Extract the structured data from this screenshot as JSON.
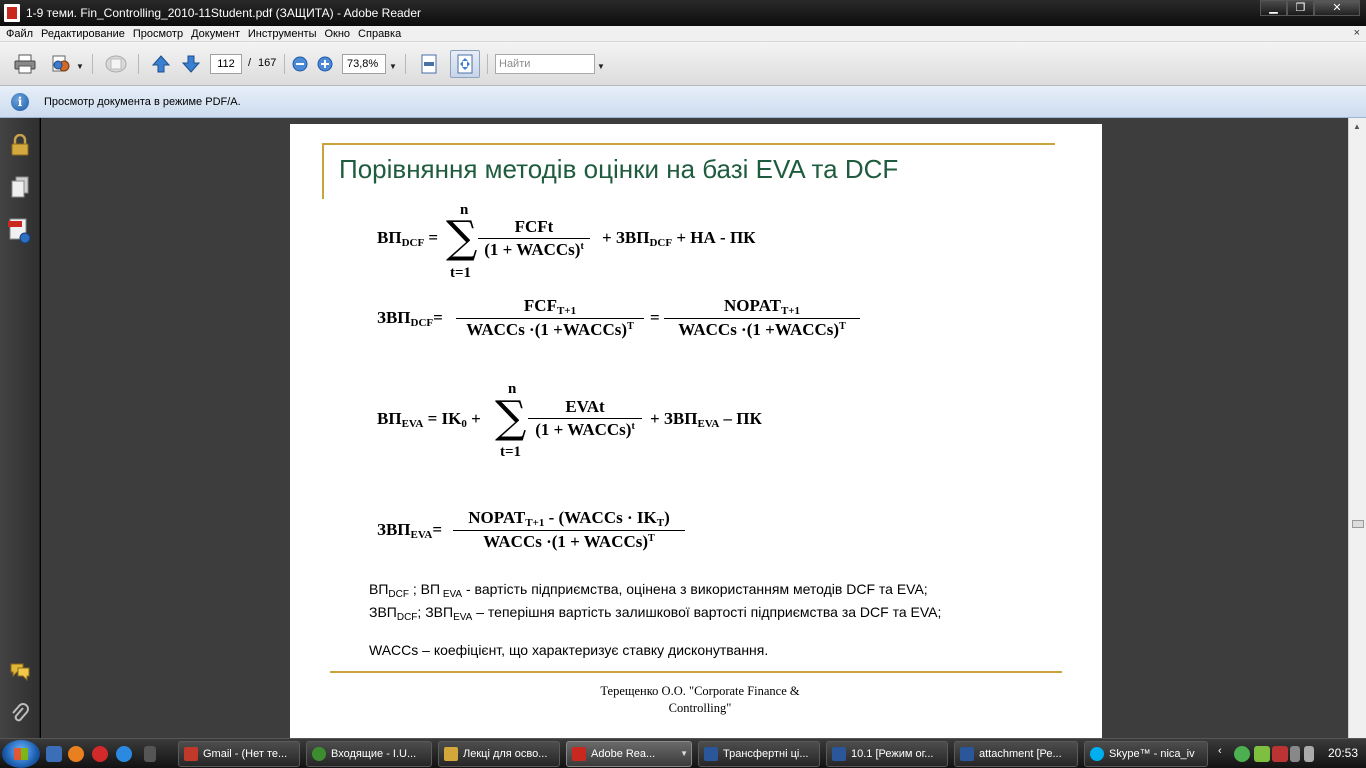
{
  "window": {
    "title": "1-9 теми. Fin_Controlling_2010-11Student.pdf (ЗАЩИТА) - Adobe Reader",
    "min": "▁",
    "max": "❐",
    "close": "✕"
  },
  "menu": {
    "items": [
      "Файл",
      "Редактирование",
      "Просмотр",
      "Документ",
      "Инструменты",
      "Окно",
      "Справка"
    ],
    "close": "×"
  },
  "toolbar": {
    "page_current": "112",
    "page_sep": "/",
    "page_total": "167",
    "zoom": "73,8%",
    "search_placeholder": "Найти"
  },
  "infobar": {
    "icon": "i",
    "text": "Просмотр документа в режиме PDF/A."
  },
  "slide": {
    "title": "Порівняння методів оцінки на базі EVA  та DCF",
    "eq1": {
      "lhs": "ВП",
      "lhs_sub": "DCF",
      "eq": " =",
      "sum_top": "n",
      "sum_bottom": "t=1",
      "num": "FCFt",
      "den": "(1 + WACCs)",
      "den_sup": "t",
      "rhs_a": "+ ЗВП",
      "rhs_sub": "DCF",
      "rhs_b": "+ НА - ПК"
    },
    "eq2": {
      "lhs": "ЗВП",
      "lhs_sub": "DCF",
      "eq": "=",
      "num1": "FCF",
      "num1_sub": "T+1",
      "den1": "WACCs ·(1 +WACCs)",
      "den1_sup": "T",
      "eq2": "=",
      "num2": "NOPAT",
      "num2_sub": "T+1",
      "den2": "WACCs ·(1 +WACCs)",
      "den2_sup": "T"
    },
    "eq3": {
      "lhs": "ВП",
      "lhs_sub": "EVA",
      "eq": "  = IK",
      "ik_sub": "0",
      "plus": " +",
      "sum_top": "n",
      "sum_bottom": "t=1",
      "num": "EVAt",
      "den": "(1 + WACCs)",
      "den_sup": "t",
      "rhs_a": "+ ЗВП",
      "rhs_sub": "EVA",
      "rhs_b": "– ПК"
    },
    "eq4": {
      "lhs": "ЗВП",
      "lhs_sub": "EVA",
      "eq": "=",
      "num_a": "NOPAT",
      "num_sub": "T+1",
      "num_b": " - (WACCs · IK",
      "num_sub2": "T",
      "num_c": ")",
      "den": "WACCs ·(1 + WACCs)",
      "den_sup": "T"
    },
    "legend1": {
      "a": "ВП",
      "a_sub": "DCF",
      "b": " ; ВП",
      "b_sub": " EVA",
      "c": "  - вартість підприємства, оцінена з використанням методів DCF та EVA;"
    },
    "legend2": {
      "a": "ЗВП",
      "a_sub": "DCF",
      "b": "; ЗВП",
      "b_sub": "EVA",
      "c": " – теперішня вартість залишкової вартості підприємства за DCF та EVA;"
    },
    "legend3": "WACCs – коефіцієнт, що характеризує ставку дисконутвання.",
    "footer_line1": "Терещенко О.О.  \"Corporate Finance &",
    "footer_line2": "Controlling\""
  },
  "taskbar": {
    "tasks": [
      {
        "label": "Gmail - (Нет те...",
        "icon_color": "#c0392b"
      },
      {
        "label": "Входящие - I.U...",
        "icon_color": "#3c8d2f"
      },
      {
        "label": "Лекці для осво...",
        "icon_color": "#d4a73a"
      },
      {
        "label": "Adobe Rea...",
        "icon_color": "#c8281e"
      },
      {
        "label": "Трансфертні ці...",
        "icon_color": "#2b579a"
      },
      {
        "label": "10.1 [Режим ог...",
        "icon_color": "#2b579a"
      },
      {
        "label": "attachment [Ре...",
        "icon_color": "#2b579a"
      },
      {
        "label": "Skype™ - nica_iv",
        "icon_color": "#00aff0"
      }
    ],
    "clock": "20:53"
  },
  "colors": {
    "title_green": "#1f5c3f",
    "gold_rule": "#c9a43b",
    "doc_bg": "#3d3d3d"
  }
}
